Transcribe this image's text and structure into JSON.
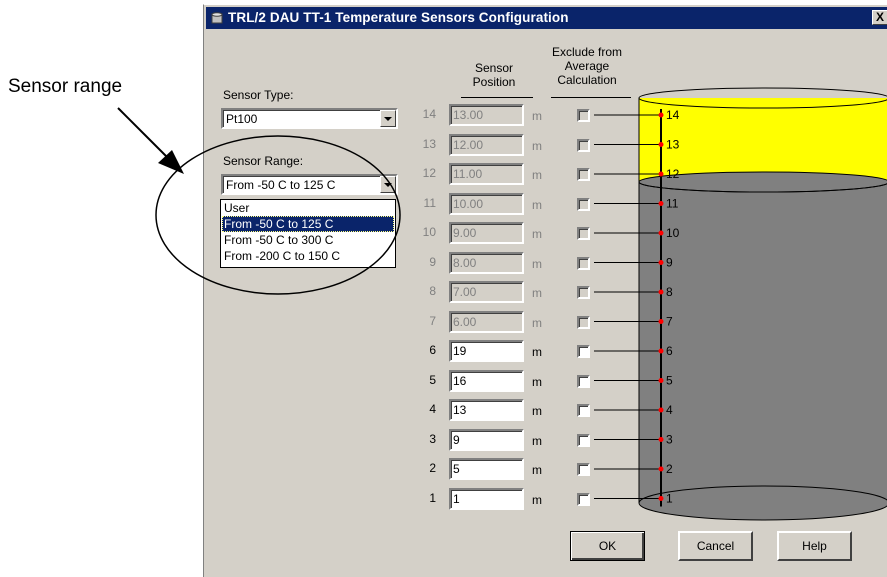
{
  "callout": "Sensor range",
  "window": {
    "title": "TRL/2 DAU TT-1 Temperature Sensors Configuration",
    "close_label": "X"
  },
  "sensor_type": {
    "label": "Sensor Type:",
    "value": "Pt100"
  },
  "sensor_range": {
    "label": "Sensor Range:",
    "value": "From -50 C to 125 C",
    "options": [
      "User",
      "From -50 C to 125 C",
      "From -50 C to 300 C",
      "From -200 C to 150 C"
    ],
    "selected_index": 1
  },
  "headers": {
    "position": [
      "Sensor",
      "Position"
    ],
    "exclude": [
      "Exclude from",
      "Average",
      "Calculation"
    ]
  },
  "unit": "m",
  "sensors": [
    {
      "num": "14",
      "pos": "13.00",
      "enabled": false
    },
    {
      "num": "13",
      "pos": "12.00",
      "enabled": false
    },
    {
      "num": "12",
      "pos": "11.00",
      "enabled": false
    },
    {
      "num": "11",
      "pos": "10.00",
      "enabled": false
    },
    {
      "num": "10",
      "pos": "9.00",
      "enabled": false
    },
    {
      "num": "9",
      "pos": "8.00",
      "enabled": false
    },
    {
      "num": "8",
      "pos": "7.00",
      "enabled": false
    },
    {
      "num": "7",
      "pos": "6.00",
      "enabled": false
    },
    {
      "num": "6",
      "pos": "19",
      "enabled": true
    },
    {
      "num": "5",
      "pos": "16",
      "enabled": true
    },
    {
      "num": "4",
      "pos": "13",
      "enabled": true
    },
    {
      "num": "3",
      "pos": "9",
      "enabled": true
    },
    {
      "num": "2",
      "pos": "5",
      "enabled": true
    },
    {
      "num": "1",
      "pos": "1",
      "enabled": true
    }
  ],
  "colors": {
    "titlebar": "#0a246a",
    "dialog": "#d4d0c8",
    "liquid_top": "#ffff00",
    "tank": "#808080",
    "sensor_dot": "#ff0000"
  },
  "buttons": {
    "ok": "OK",
    "cancel": "Cancel",
    "help": "Help"
  }
}
